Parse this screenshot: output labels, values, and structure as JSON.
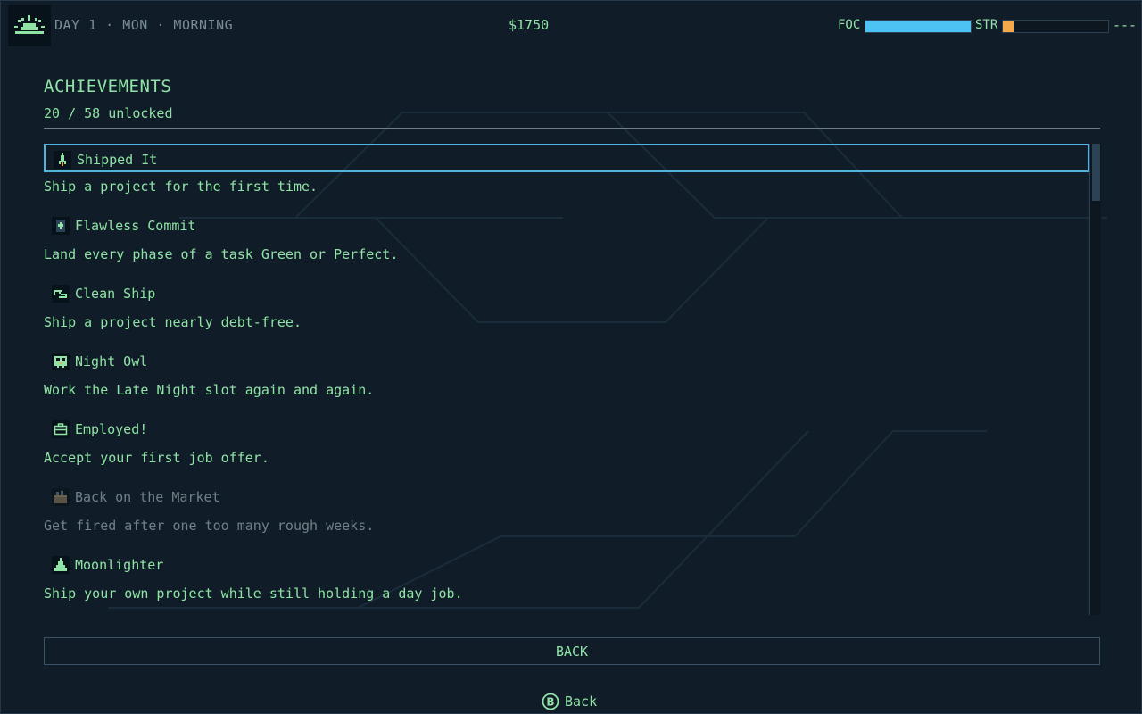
{
  "hud": {
    "time_icon": "sunrise-icon",
    "day_label": "DAY 1 · MON · MORNING",
    "money": "$1750",
    "focus_label": "FOC",
    "focus_level": 1.0,
    "focus_color": "#4dc3f3",
    "stress_label": "STR",
    "stress_level": 0.1,
    "stress_color": "#f5a94b",
    "menu_text": "---"
  },
  "panel": {
    "title": "ACHIEVEMENTS",
    "unlocked_text": "20 / 58 unlocked"
  },
  "achievements": [
    {
      "name": "Shipped It",
      "description": "Ship a project for the first time.",
      "icon": "rocket-icon",
      "unlocked": true,
      "selected": true
    },
    {
      "name": "Flawless Commit",
      "description": "Land every phase of a task Green or Perfect.",
      "icon": "spade-card-icon",
      "unlocked": true,
      "selected": false
    },
    {
      "name": "Clean Ship",
      "description": "Ship a project nearly debt-free.",
      "icon": "broom-icon",
      "unlocked": true,
      "selected": false
    },
    {
      "name": "Night Owl",
      "description": "Work the Late Night slot again and again.",
      "icon": "owl-icon",
      "unlocked": true,
      "selected": false
    },
    {
      "name": "Employed!",
      "description": "Accept your first job offer.",
      "icon": "briefcase-icon",
      "unlocked": true,
      "selected": false
    },
    {
      "name": "Back on the Market",
      "description": "Get fired after one too many rough weeks.",
      "icon": "box-icon",
      "unlocked": false,
      "selected": false
    },
    {
      "name": "Moonlighter",
      "description": "Ship your own project while still holding a day job.",
      "icon": "ship-icon",
      "unlocked": true,
      "selected": false
    }
  ],
  "colors": {
    "background": "#101d29",
    "text": "#8fe3a4",
    "locked_text": "#6f8086",
    "selection_border": "#4fb3dd"
  },
  "footer": {
    "back_button_label": "BACK",
    "hint_icon": "b-button-icon",
    "hint_label": "Back"
  }
}
